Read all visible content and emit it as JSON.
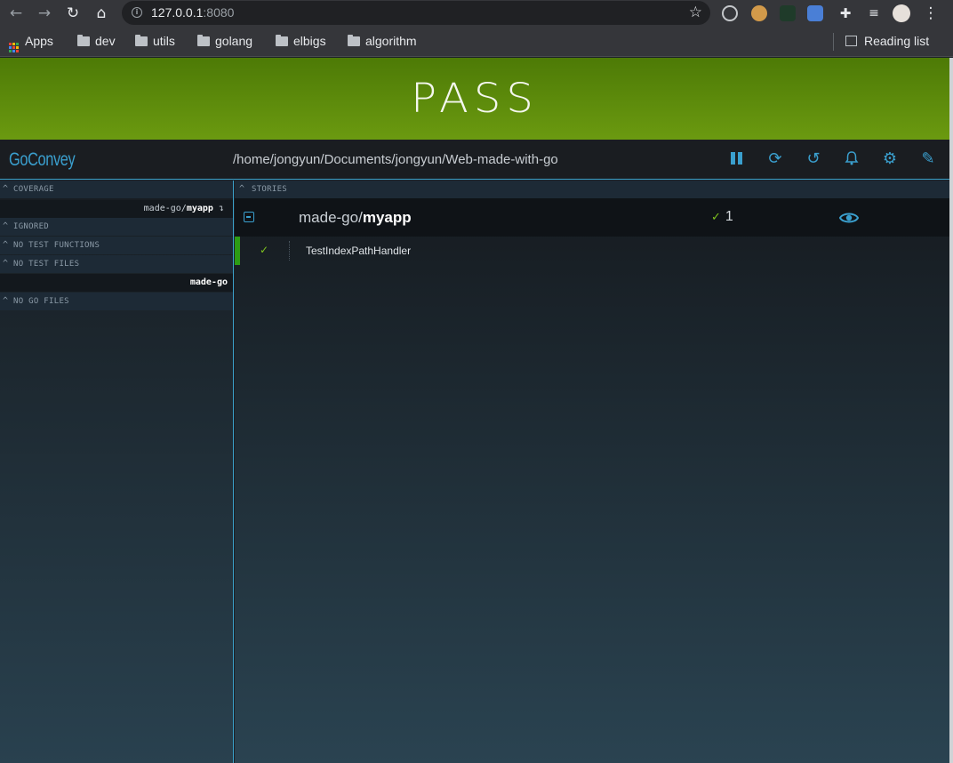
{
  "browser": {
    "url_host": "127.0.0.1",
    "url_port": ":8080",
    "bookmarks": [
      "Apps",
      "dev",
      "utils",
      "golang",
      "elbigs",
      "algorithm"
    ],
    "reading_list": "Reading list"
  },
  "banner": {
    "status": "PASS",
    "color": "#5c8a0b"
  },
  "header": {
    "logo": "GoConvey",
    "path": "/home/jongyun/Documents/jongyun/Web-made-with-go",
    "accent": "#3a9fce"
  },
  "left": {
    "coverage_label": "COVERAGE",
    "coverage_pkg_prefix": "made-go/",
    "coverage_pkg_name": "myapp",
    "coverage_suffix": "↴",
    "ignored_label": "IGNORED",
    "no_test_functions_label": "NO TEST FUNCTIONS",
    "no_test_files_label": "NO TEST FILES",
    "no_test_files_item": "made-go",
    "no_go_files_label": "NO GO FILES"
  },
  "stories": {
    "label": "STORIES",
    "package_prefix": "made-go/",
    "package_name": "myapp",
    "pass_count": "1",
    "tests": [
      {
        "name": "TestIndexPathHandler",
        "status": "pass"
      }
    ]
  }
}
